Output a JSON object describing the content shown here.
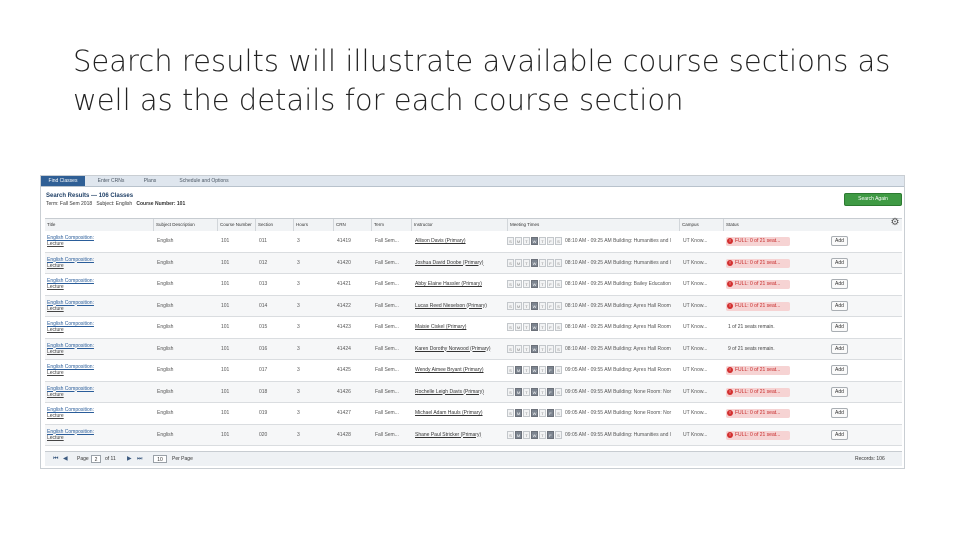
{
  "slide": {
    "title": "Search results will illustrate available course sections as well as the details for each course section"
  },
  "app": {
    "tabs": [
      "Find Classes",
      "Enter CRNs",
      "Plans",
      "Schedule and Options"
    ],
    "active_tab": 0,
    "results_title": "Search Results — 106 Classes",
    "term_label": "Term: Fall Sem 2018",
    "subject_label": "Subject: English",
    "course_label": "Course Number: 101",
    "search_again_label": "Search Again",
    "columns": [
      "Title",
      "Subject Description",
      "Course Number",
      "Section",
      "Hours",
      "CRN",
      "Term",
      "Instructor",
      "Meeting Times",
      "Campus",
      "Status"
    ],
    "rows": [
      {
        "title1": "English Composition:",
        "title2": "Lecture",
        "subject": "English",
        "course": "101",
        "section": "011",
        "hours": "3",
        "crn": "41419",
        "term": "Fall Sem...",
        "instructor": "Allison Davis (Primary)",
        "days": [
          "S",
          "M",
          "T",
          "W",
          "T",
          "F",
          "S"
        ],
        "active_days": [
          3
        ],
        "time": "08:10 AM - 09:25 AM Building: Humanities and l",
        "campus": "UT Know...",
        "status_type": "full",
        "status": "FULL: 0 of 21 seat...",
        "add": "Add"
      },
      {
        "title1": "English Composition:",
        "title2": "Lecture",
        "subject": "English",
        "course": "101",
        "section": "012",
        "hours": "3",
        "crn": "41420",
        "term": "Fall Sem...",
        "instructor": "Joshua David Doobe (Primary)",
        "days": [
          "S",
          "M",
          "T",
          "W",
          "T",
          "F",
          "S"
        ],
        "active_days": [
          3
        ],
        "time": "08:10 AM - 09:25 AM Building: Humanities and l",
        "campus": "UT Know...",
        "status_type": "full",
        "status": "FULL: 0 of 21 seat...",
        "add": "Add"
      },
      {
        "title1": "English Composition:",
        "title2": "Lecture",
        "subject": "English",
        "course": "101",
        "section": "013",
        "hours": "3",
        "crn": "41421",
        "term": "Fall Sem...",
        "instructor": "Abby Elaine Hassler (Primary)",
        "days": [
          "S",
          "M",
          "T",
          "W",
          "T",
          "F",
          "S"
        ],
        "active_days": [
          3
        ],
        "time": "08:10 AM - 09:25 AM Building: Bailey Education",
        "campus": "UT Know...",
        "status_type": "full",
        "status": "FULL: 0 of 21 seat...",
        "add": "Add"
      },
      {
        "title1": "English Composition:",
        "title2": "Lecture",
        "subject": "English",
        "course": "101",
        "section": "014",
        "hours": "3",
        "crn": "41422",
        "term": "Fall Sem...",
        "instructor": "Lucas Reed Nieselson (Primary)",
        "days": [
          "S",
          "M",
          "T",
          "W",
          "T",
          "F",
          "S"
        ],
        "active_days": [
          3
        ],
        "time": "08:10 AM - 09:25 AM Building: Ayres Hall Room",
        "campus": "UT Know...",
        "status_type": "full",
        "status": "FULL: 0 of 21 seat...",
        "add": "Add"
      },
      {
        "title1": "English Composition:",
        "title2": "Lecture",
        "subject": "English",
        "course": "101",
        "section": "015",
        "hours": "3",
        "crn": "41423",
        "term": "Fall Sem...",
        "instructor": "Maisie Ciskel (Primary)",
        "days": [
          "S",
          "M",
          "T",
          "W",
          "T",
          "F",
          "S"
        ],
        "active_days": [
          3
        ],
        "time": "08:10 AM - 09:25 AM Building: Ayres Hall Room",
        "campus": "UT Know...",
        "status_type": "open",
        "status": "1 of 21 seats remain.",
        "add": "Add"
      },
      {
        "title1": "English Composition:",
        "title2": "Lecture",
        "subject": "English",
        "course": "101",
        "section": "016",
        "hours": "3",
        "crn": "41424",
        "term": "Fall Sem...",
        "instructor": "Karen Dorothy Norwood (Primary)",
        "days": [
          "S",
          "M",
          "T",
          "W",
          "T",
          "F",
          "S"
        ],
        "active_days": [
          3
        ],
        "time": "08:10 AM - 09:25 AM Building: Ayres Hall Room",
        "campus": "UT Know...",
        "status_type": "open",
        "status": "9 of 21 seats remain.",
        "add": "Add"
      },
      {
        "title1": "English Composition:",
        "title2": "Lecture",
        "subject": "English",
        "course": "101",
        "section": "017",
        "hours": "3",
        "crn": "41425",
        "term": "Fall Sem...",
        "instructor": "Wendy Aimee Bryant (Primary)",
        "days": [
          "S",
          "M",
          "T",
          "W",
          "T",
          "F",
          "S"
        ],
        "active_days": [
          1,
          3,
          5
        ],
        "time": "09:05 AM - 09:55 AM Building: Ayres Hall Room",
        "campus": "UT Know...",
        "status_type": "full",
        "status": "FULL: 0 of 21 seat...",
        "add": "Add"
      },
      {
        "title1": "English Composition:",
        "title2": "Lecture",
        "subject": "English",
        "course": "101",
        "section": "018",
        "hours": "3",
        "crn": "41426",
        "term": "Fall Sem...",
        "instructor": "Rochelle Leigh Davis (Primary)",
        "days": [
          "S",
          "M",
          "T",
          "W",
          "T",
          "F",
          "S"
        ],
        "active_days": [
          1,
          3,
          5
        ],
        "time": "09:05 AM - 09:55 AM Building: None Room: Nor",
        "campus": "UT Know...",
        "status_type": "full",
        "status": "FULL: 0 of 21 seat...",
        "add": "Add"
      },
      {
        "title1": "English Composition:",
        "title2": "Lecture",
        "subject": "English",
        "course": "101",
        "section": "019",
        "hours": "3",
        "crn": "41427",
        "term": "Fall Sem...",
        "instructor": "Michael Adam Hauls (Primary)",
        "days": [
          "S",
          "M",
          "T",
          "W",
          "T",
          "F",
          "S"
        ],
        "active_days": [
          1,
          3,
          5
        ],
        "time": "09:05 AM - 09:55 AM Building: None Room: Nor",
        "campus": "UT Know...",
        "status_type": "full",
        "status": "FULL: 0 of 21 seat...",
        "add": "Add"
      },
      {
        "title1": "English Composition:",
        "title2": "Lecture",
        "subject": "English",
        "course": "101",
        "section": "020",
        "hours": "3",
        "crn": "41428",
        "term": "Fall Sem...",
        "instructor": "Shane Paul Stricker (Primary)",
        "days": [
          "S",
          "M",
          "T",
          "W",
          "T",
          "F",
          "S"
        ],
        "active_days": [
          1,
          3,
          5
        ],
        "time": "09:05 AM - 09:55 AM Building: Humanities and l",
        "campus": "UT Know...",
        "status_type": "full",
        "status": "FULL: 0 of 21 seat...",
        "add": "Add"
      }
    ],
    "pager": {
      "page_label": "Page",
      "page_value": "2",
      "of_label": "of 11",
      "per_page_value": "10",
      "per_page_label": "Per Page",
      "records_label": "Records: 106"
    },
    "colors": {
      "accent": "#2f5f95",
      "search_button": "#3f9a44",
      "full_status": "#c62828",
      "full_bg": "#f6d3d3"
    }
  }
}
